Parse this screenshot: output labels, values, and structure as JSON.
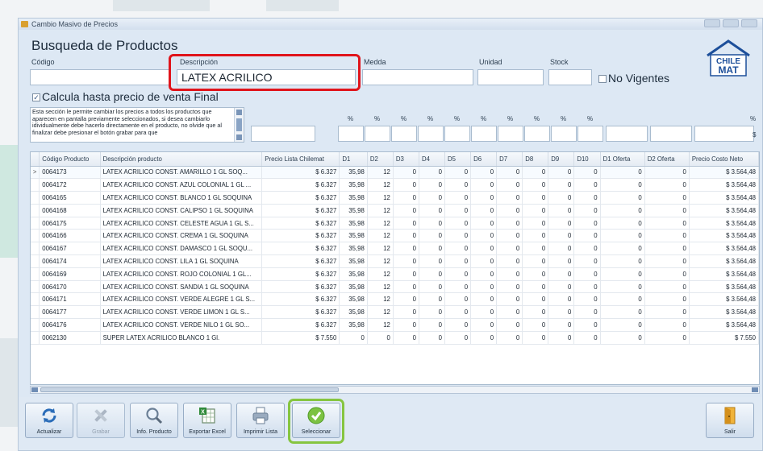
{
  "window": {
    "title": "Cambio Masivo de Precios"
  },
  "search": {
    "heading": "Busqueda de Productos",
    "codigo_label": "Código",
    "codigo_value": "",
    "descripcion_label": "Descripción",
    "descripcion_value": "LATEX ACRILICO",
    "medida_label": "Medda",
    "medida_value": "",
    "unidad_label": "Unidad",
    "unidad_value": "",
    "stock_label": "Stock",
    "stock_value": "",
    "no_vigentes_label": "No Vigentes",
    "no_vigentes_checked": false
  },
  "logo": {
    "line1": "CHILE",
    "line2": "MAT"
  },
  "calc": {
    "label": "Calcula hasta precio de venta Final",
    "checked": true
  },
  "info_text": "Esta sección le permite cambiar los precios a todos los productos que aparecen en pantalla previamente seleccionados, si desea cambiarlo idividualmente debe hacerlo directamente en el producto, no olvide que al finalizar debe presionar el botón grabar para que",
  "percent_symbol": "%",
  "dollar_symbol": "$",
  "grid": {
    "columns": [
      "Código Producto",
      "Descripción producto",
      "Precio Lista Chilemat",
      "D1",
      "D2",
      "D3",
      "D4",
      "D5",
      "D6",
      "D7",
      "D8",
      "D9",
      "D10",
      "D1 Oferta",
      "D2 Oferta",
      "Precio Costo Neto"
    ],
    "selected_indicator": ">",
    "rows": [
      [
        "0064173",
        "LATEX ACRILICO CONST. AMARILLO 1 GL SOQ...",
        "$ 6.327",
        "35,98",
        "12",
        "0",
        "0",
        "0",
        "0",
        "0",
        "0",
        "0",
        "0",
        "0",
        "0",
        "$ 3.564,48"
      ],
      [
        "0064172",
        "LATEX ACRILICO CONST. AZUL COLONIAL 1 GL ...",
        "$ 6.327",
        "35,98",
        "12",
        "0",
        "0",
        "0",
        "0",
        "0",
        "0",
        "0",
        "0",
        "0",
        "0",
        "$ 3.564,48"
      ],
      [
        "0064165",
        "LATEX ACRILICO CONST. BLANCO 1 GL SOQUINA",
        "$ 6.327",
        "35,98",
        "12",
        "0",
        "0",
        "0",
        "0",
        "0",
        "0",
        "0",
        "0",
        "0",
        "0",
        "$ 3.564,48"
      ],
      [
        "0064168",
        "LATEX ACRILICO CONST. CALIPSO 1 GL SOQUINA",
        "$ 6.327",
        "35,98",
        "12",
        "0",
        "0",
        "0",
        "0",
        "0",
        "0",
        "0",
        "0",
        "0",
        "0",
        "$ 3.564,48"
      ],
      [
        "0064175",
        "LATEX ACRILICO CONST. CELESTE AGUA 1 GL S...",
        "$ 6.327",
        "35,98",
        "12",
        "0",
        "0",
        "0",
        "0",
        "0",
        "0",
        "0",
        "0",
        "0",
        "0",
        "$ 3.564,48"
      ],
      [
        "0064166",
        "LATEX ACRILICO CONST. CREMA 1 GL SOQUINA",
        "$ 6.327",
        "35,98",
        "12",
        "0",
        "0",
        "0",
        "0",
        "0",
        "0",
        "0",
        "0",
        "0",
        "0",
        "$ 3.564,48"
      ],
      [
        "0064167",
        "LATEX ACRILICO CONST. DAMASCO 1 GL SOQU...",
        "$ 6.327",
        "35,98",
        "12",
        "0",
        "0",
        "0",
        "0",
        "0",
        "0",
        "0",
        "0",
        "0",
        "0",
        "$ 3.564,48"
      ],
      [
        "0064174",
        "LATEX ACRILICO CONST. LILA 1 GL SOQUINA",
        "$ 6.327",
        "35,98",
        "12",
        "0",
        "0",
        "0",
        "0",
        "0",
        "0",
        "0",
        "0",
        "0",
        "0",
        "$ 3.564,48"
      ],
      [
        "0064169",
        "LATEX ACRILICO CONST. ROJO COLONIAL 1 GL...",
        "$ 6.327",
        "35,98",
        "12",
        "0",
        "0",
        "0",
        "0",
        "0",
        "0",
        "0",
        "0",
        "0",
        "0",
        "$ 3.564,48"
      ],
      [
        "0064170",
        "LATEX ACRILICO CONST. SANDIA 1 GL SOQUINA",
        "$ 6.327",
        "35,98",
        "12",
        "0",
        "0",
        "0",
        "0",
        "0",
        "0",
        "0",
        "0",
        "0",
        "0",
        "$ 3.564,48"
      ],
      [
        "0064171",
        "LATEX ACRILICO CONST. VERDE ALEGRE 1 GL S...",
        "$ 6.327",
        "35,98",
        "12",
        "0",
        "0",
        "0",
        "0",
        "0",
        "0",
        "0",
        "0",
        "0",
        "0",
        "$ 3.564,48"
      ],
      [
        "0064177",
        "LATEX ACRILICO CONST. VERDE LIMON 1 GL S...",
        "$ 6.327",
        "35,98",
        "12",
        "0",
        "0",
        "0",
        "0",
        "0",
        "0",
        "0",
        "0",
        "0",
        "0",
        "$ 3.564,48"
      ],
      [
        "0064176",
        "LATEX ACRILICO CONST. VERDE NILO 1 GL SO...",
        "$ 6.327",
        "35,98",
        "12",
        "0",
        "0",
        "0",
        "0",
        "0",
        "0",
        "0",
        "0",
        "0",
        "0",
        "$ 3.564,48"
      ],
      [
        "0062130",
        "SUPER LATEX ACRILICO BLANCO 1 Gl.",
        "$ 7.550",
        "0",
        "0",
        "0",
        "0",
        "0",
        "0",
        "0",
        "0",
        "0",
        "0",
        "0",
        "0",
        "$ 7.550"
      ]
    ]
  },
  "toolbar": {
    "buttons": [
      {
        "label": "Actualizar",
        "icon": "refresh-icon",
        "enabled": true
      },
      {
        "label": "Grabar",
        "icon": "tools-icon",
        "enabled": false
      },
      {
        "label": "Info. Producto",
        "icon": "magnifier-icon",
        "enabled": true
      },
      {
        "label": "Exportar Excel",
        "icon": "excel-icon",
        "enabled": true
      },
      {
        "label": "Imprimir Lista",
        "icon": "printer-icon",
        "enabled": true
      },
      {
        "label": "Seleccionar",
        "icon": "check-circle-icon",
        "enabled": true
      },
      {
        "label": "Salir",
        "icon": "exit-door-icon",
        "enabled": true
      }
    ]
  },
  "colors": {
    "accent_red": "#e0141b",
    "accent_green": "#86c540",
    "window_bg": "#dde8f4"
  }
}
